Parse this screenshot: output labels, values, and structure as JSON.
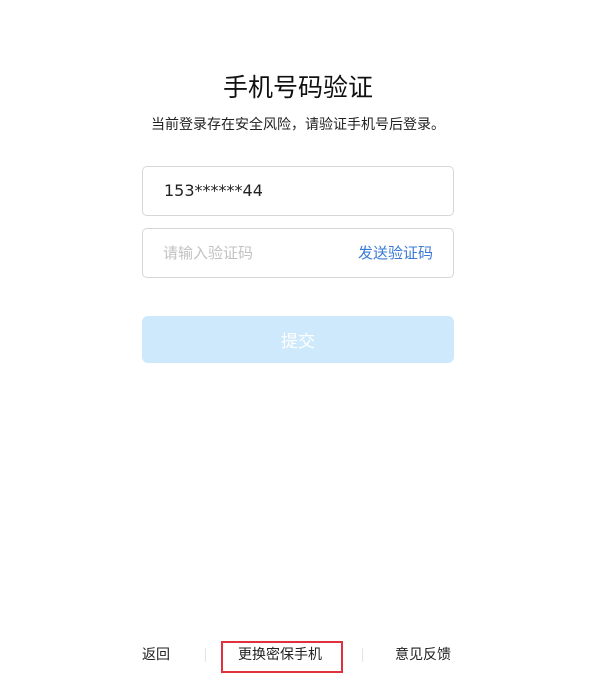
{
  "header": {
    "title": "手机号码验证",
    "subtitle": "当前登录存在安全风险，请验证手机号后登录。"
  },
  "form": {
    "phone_value": "153******44",
    "code_placeholder": "请输入验证码",
    "code_value": "",
    "send_code_label": "发送验证码",
    "submit_label": "提交"
  },
  "footer": {
    "back_label": "返回",
    "change_phone_label": "更换密保手机",
    "feedback_label": "意见反馈"
  },
  "colors": {
    "link_blue": "#3a7ad6",
    "submit_disabled_bg": "#cde9fb",
    "highlight_red": "#e0323c"
  }
}
